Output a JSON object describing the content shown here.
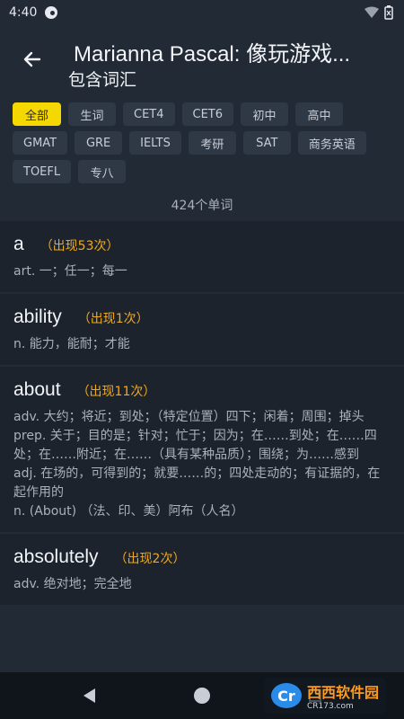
{
  "status": {
    "time": "4:40"
  },
  "header": {
    "title": "Marianna Pascal: 像玩游戏...",
    "subtitle": "包含词汇"
  },
  "filters": [
    "全部",
    "生词",
    "CET4",
    "CET6",
    "初中",
    "高中",
    "GMAT",
    "GRE",
    "IELTS",
    "考研",
    "SAT",
    "商务英语",
    "TOEFL",
    "专八"
  ],
  "filters_active_index": 0,
  "count_text": "424个单词",
  "words": [
    {
      "word": "a",
      "occurrence": "（出现53次）",
      "definitions": [
        "art. 一；任一；每一"
      ]
    },
    {
      "word": "ability",
      "occurrence": "（出现1次）",
      "definitions": [
        "n. 能力，能耐；才能"
      ]
    },
    {
      "word": "about",
      "occurrence": "（出现11次）",
      "definitions": [
        "adv. 大约；将近；到处；（特定位置）四下；闲着；周围；掉头",
        "prep. 关于；目的是；针对；忙于；因为；在……到处；在……四处；在……附近；在……（具有某种品质）；围绕；为……感到",
        "adj. 在场的，可得到的；就要……的；四处走动的；有证据的，在起作用的",
        "n. (About) （法、印、美）阿布（人名）"
      ]
    },
    {
      "word": "absolutely",
      "occurrence": "（出现2次）",
      "definitions": [
        "adv. 绝对地；完全地"
      ]
    }
  ],
  "watermark": {
    "logo": "Cr",
    "text": "西西软件园",
    "sub": "CR173.com"
  },
  "colors": {
    "accent": "#f5d800",
    "occurrence": "#f0a91b",
    "background": "#222a35",
    "card": "#1c232d"
  }
}
